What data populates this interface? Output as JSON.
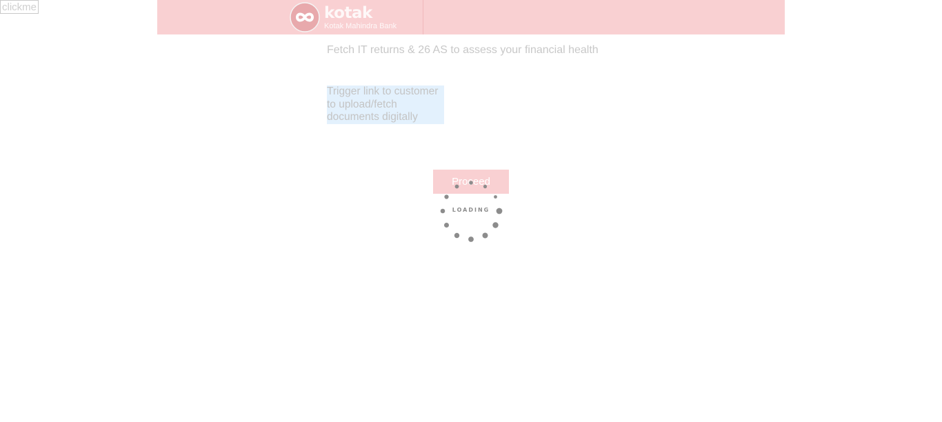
{
  "debug": {
    "clickme_label": "clickme"
  },
  "header": {
    "brand_name": "kotak",
    "brand_subtitle": "Kotak Mahindra Bank"
  },
  "main": {
    "title": "Fetch IT returns & 26 AS to assess your financial health",
    "trigger_link_label": "Trigger link to customer to upload/fetch documents digitally",
    "proceed_label": "Proceed"
  },
  "loader": {
    "text": "LOADING"
  },
  "colors": {
    "header_bg": "#f9d0d2",
    "trigger_bg": "#e3f1fd",
    "muted_text": "#c8c8c8",
    "spinner_dot": "#8c8c8c"
  },
  "icons": {
    "logo": "kotak-infinity-logo-icon",
    "spinner": "loading-spinner-icon"
  }
}
